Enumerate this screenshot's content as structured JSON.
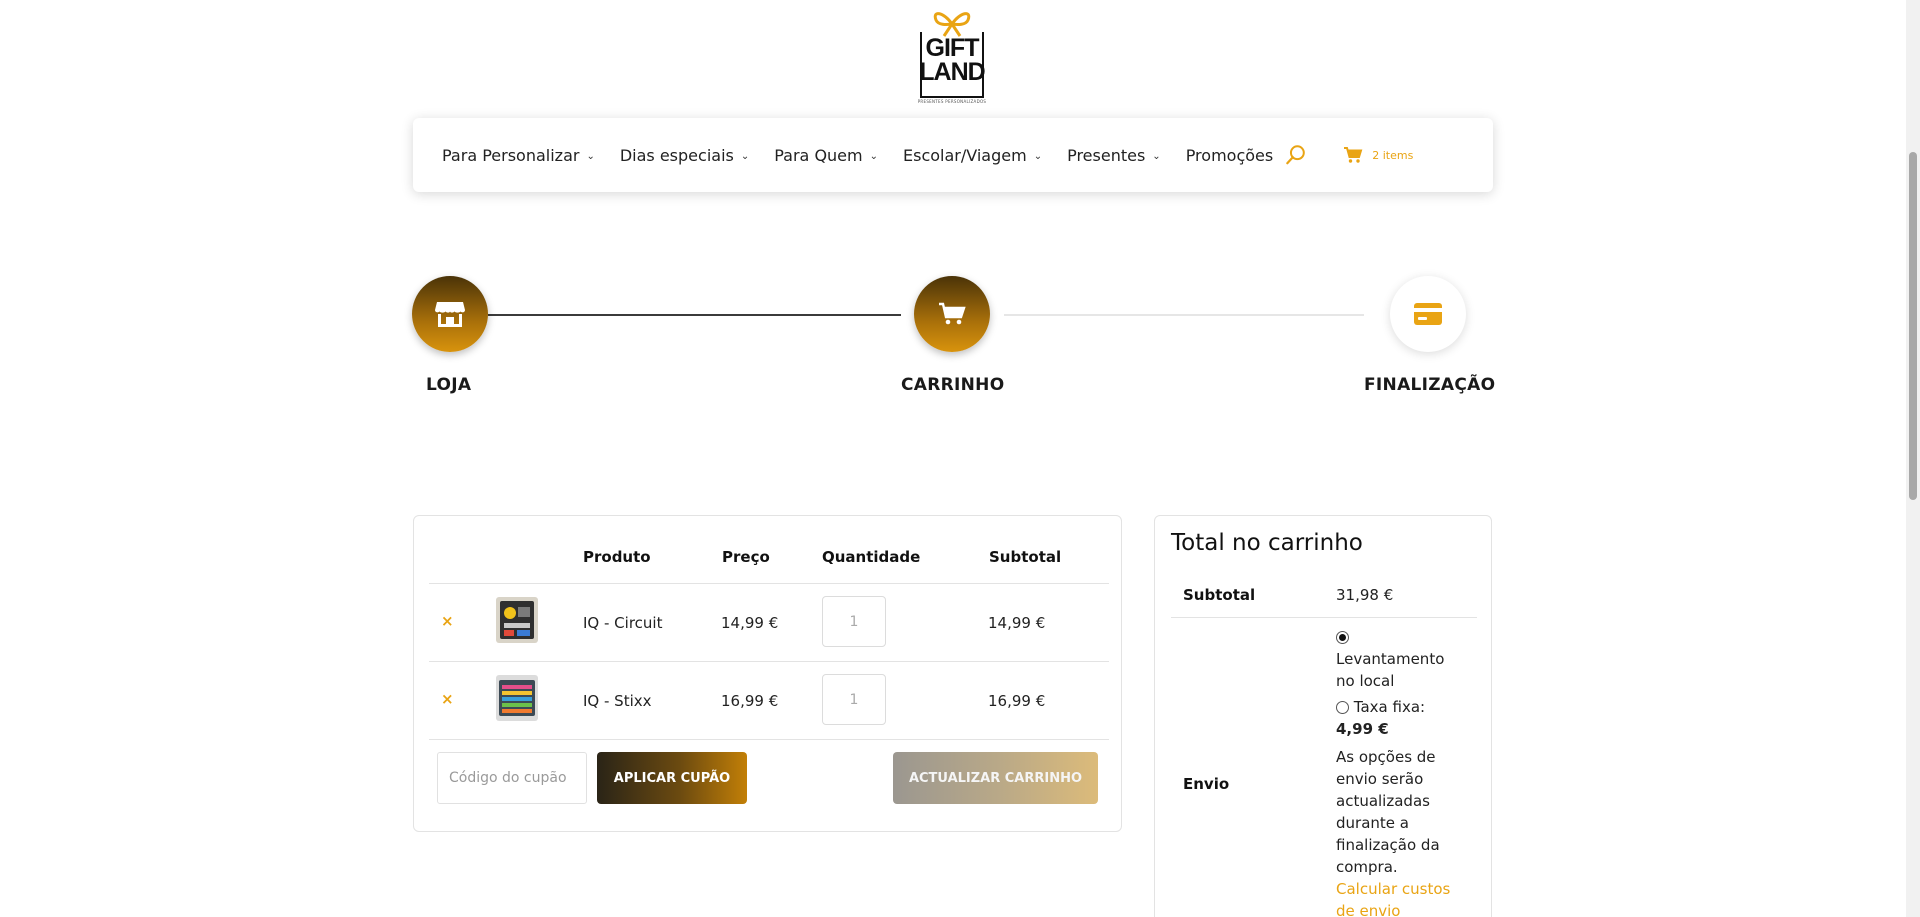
{
  "brand": {
    "logo_line1": "GIFT",
    "logo_line2": "LAND",
    "logo_tagline": "PRESENTES PERSONALIZADOS",
    "accent_color": "#e9a414"
  },
  "nav": {
    "items": [
      {
        "label": "Para Personalizar",
        "has_dropdown": true
      },
      {
        "label": "Dias especiais",
        "has_dropdown": true
      },
      {
        "label": "Para Quem",
        "has_dropdown": true
      },
      {
        "label": "Escolar/Viagem",
        "has_dropdown": true
      },
      {
        "label": "Presentes",
        "has_dropdown": true
      },
      {
        "label": "Promoções",
        "has_dropdown": false
      }
    ],
    "search_icon": "search-icon",
    "cart_icon": "cart-icon",
    "cart_count_label": "2 items"
  },
  "steps": [
    {
      "label": "LOJA",
      "icon": "store-icon",
      "active": true
    },
    {
      "label": "CARRINHO",
      "icon": "cart-icon",
      "active": true
    },
    {
      "label": "FINALIZAÇÃO",
      "icon": "credit-card-icon",
      "active": false
    }
  ],
  "cart": {
    "headers": {
      "product": "Produto",
      "price": "Preço",
      "quantity": "Quantidade",
      "subtotal": "Subtotal"
    },
    "rows": [
      {
        "name": "IQ - Circuit",
        "price": "14,99 €",
        "quantity": "1",
        "subtotal": "14,99 €"
      },
      {
        "name": "IQ - Stixx",
        "price": "16,99 €",
        "quantity": "1",
        "subtotal": "16,99 €"
      }
    ],
    "remove_symbol": "×",
    "coupon_placeholder": "Código do cupão",
    "apply_coupon_label": "APLICAR CUPÃO",
    "update_cart_label": "ACTUALIZAR CARRINHO"
  },
  "totals": {
    "title": "Total no carrinho",
    "subtotal_label": "Subtotal",
    "subtotal_value": "31,98 €",
    "shipping_label": "Envio",
    "shipping_options": [
      {
        "label": "Levantamento no local",
        "checked": true
      },
      {
        "label": "Taxa fixa:",
        "price": "4,99 €",
        "checked": false
      }
    ],
    "shipping_note": "As opções de envio serão actualizadas durante a finalização da compra.",
    "calc_link": "Calcular custos de envio"
  }
}
